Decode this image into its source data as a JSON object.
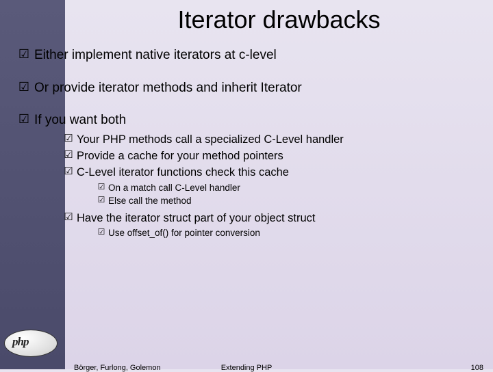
{
  "title": "Iterator drawbacks",
  "bullets": [
    {
      "text": "Either implement native iterators at c-level"
    },
    {
      "text": "Or provide iterator methods and inherit Iterator"
    },
    {
      "text": "If you want both"
    }
  ],
  "sub1": [
    "Your PHP methods call a specialized C-Level handler",
    "Provide a cache for your method pointers",
    "C-Level iterator functions check this cache"
  ],
  "sub2a": [
    "On a match call C-Level handler",
    "Else call the method"
  ],
  "sub1b": [
    "Have the iterator struct part of your object struct"
  ],
  "sub2b": [
    "Use offset_of() for pointer conversion"
  ],
  "footer": {
    "left": "Börger, Furlong, Golemon",
    "center": "Extending PHP",
    "right": "108"
  },
  "logo": "php",
  "checkmark": "☑"
}
